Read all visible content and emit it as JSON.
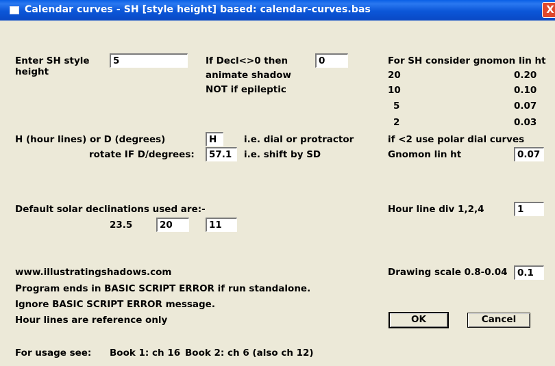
{
  "window": {
    "title": "Calendar curves - SH [style height] based:  calendar-curves.bas",
    "close_glyph": "X"
  },
  "style_height": {
    "label_line1": "Enter SH style",
    "label_line2": "height",
    "value": "5"
  },
  "animate": {
    "line1": "If Decl<>0 then",
    "line2": "animate shadow",
    "line3": "NOT if epileptic",
    "value": "0"
  },
  "gnomon_table": {
    "header": "For SH consider gnomon lin ht",
    "rows": [
      {
        "sh": "20",
        "ht": "0.20"
      },
      {
        "sh": "10",
        "ht": "0.10"
      },
      {
        "sh": "5",
        "ht": "0.07"
      },
      {
        "sh": "2",
        "ht": "0.03"
      }
    ],
    "note": "if <2 use polar dial curves"
  },
  "hour_mode": {
    "label": "H (hour lines) or D (degrees)",
    "value": "H",
    "hint": "i.e. dial or protractor"
  },
  "rotate": {
    "label": "rotate IF D/degrees:",
    "value": "57.1",
    "hint": "i.e. shift by SD"
  },
  "gnomon_lin_ht": {
    "label": "Gnomon lin ht",
    "value": "0.07"
  },
  "declinations": {
    "label": "Default solar declinations used are:-",
    "first": "23.5",
    "second": "20",
    "third": "11"
  },
  "hour_line_div": {
    "label": "Hour line div 1,2,4",
    "value": "1"
  },
  "notes": {
    "website": "www.illustratingshadows.com",
    "line1": "Program ends in BASIC SCRIPT ERROR if run standalone.",
    "line2": "Ignore BASIC SCRIPT ERROR message.",
    "line3": "Hour lines are reference only"
  },
  "drawing_scale": {
    "label": "Drawing scale 0.8-0.04",
    "value": "0.1"
  },
  "buttons": {
    "ok": "OK",
    "cancel": "Cancel"
  },
  "usage": {
    "label": "For usage see:",
    "book1": "Book 1: ch 16",
    "book2": "Book 2: ch 6 (also ch 12)"
  }
}
